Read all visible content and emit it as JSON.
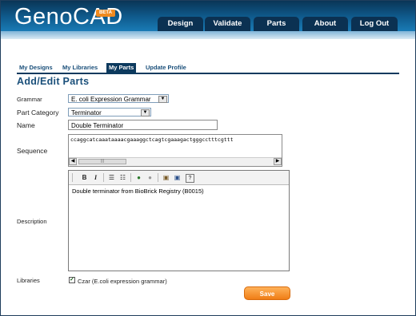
{
  "app": {
    "logo": "GenoCAD",
    "badge": "BETA"
  },
  "topnav": [
    {
      "label": "Design"
    },
    {
      "label": "Validate"
    },
    {
      "label": "Parts"
    },
    {
      "label": "About"
    },
    {
      "label": "Log Out"
    }
  ],
  "subtabs": [
    {
      "label": "My Designs",
      "active": false
    },
    {
      "label": "My Libraries",
      "active": false
    },
    {
      "label": "My Parts",
      "active": true
    },
    {
      "label": "Update Profile",
      "active": false
    }
  ],
  "page": {
    "title": "Add/Edit Parts"
  },
  "form": {
    "grammar_label": "Grammar",
    "grammar_value": "E. coli Expression Grammar",
    "category_label": "Part Category",
    "category_value": "Terminator",
    "name_label": "Name",
    "name_value": "Double Terminator",
    "sequence_label": "Sequence",
    "sequence_value": "ccaggcatcaaataaaacgaaaggctcagtcgaaagactgggcctttcgttt",
    "description_label": "Description",
    "description_value": "Double terminator from BioBrick Registry (B0015)",
    "libraries_label": "Libraries",
    "library_option": "Czar (E.coli expression grammar)",
    "library_checked": true,
    "save_label": "Save"
  },
  "colors": {
    "accent": "#f08a1e",
    "nav": "#0b3152",
    "header": "#0f5a8c"
  },
  "toolbar_icons": [
    "bold-icon",
    "italic-icon",
    "numbered-list-icon",
    "bullet-list-icon",
    "link-icon",
    "unlink-icon",
    "paste-icon",
    "paste-word-icon",
    "help-icon"
  ]
}
